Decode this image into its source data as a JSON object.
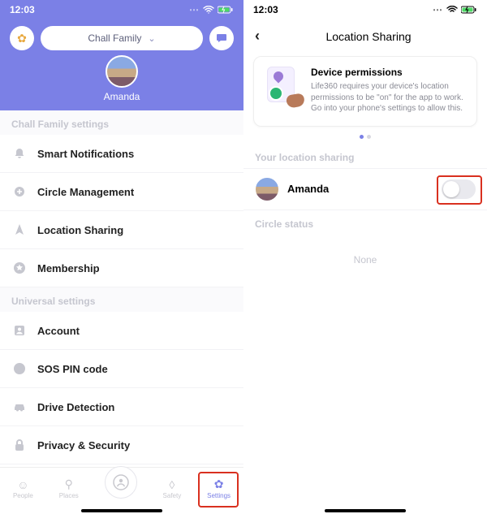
{
  "status": {
    "time": "12:03",
    "signal": "⋯",
    "wifi": "✓",
    "battery": "⚡"
  },
  "left": {
    "family_name": "Chall Family",
    "profile_name": "Amanda",
    "section1": "Chall Family settings",
    "items1": [
      {
        "label": "Smart Notifications"
      },
      {
        "label": "Circle Management"
      },
      {
        "label": "Location Sharing"
      },
      {
        "label": "Membership"
      }
    ],
    "section2": "Universal settings",
    "items2": [
      {
        "label": "Account"
      },
      {
        "label": "SOS PIN code"
      },
      {
        "label": "Drive Detection"
      },
      {
        "label": "Privacy & Security"
      }
    ],
    "tabs": {
      "people": "People",
      "places": "Places",
      "safety": "Safety",
      "settings": "Settings"
    }
  },
  "right": {
    "title": "Location Sharing",
    "card": {
      "title": "Device permissions",
      "text": "Life360 requires your device's location permissions to be \"on\" for the app to work. Go into your phone's settings to allow this."
    },
    "your_location_sharing": "Your location sharing",
    "user_name": "Amanda",
    "toggle_on": false,
    "circle_status_label": "Circle status",
    "circle_status_value": "None"
  }
}
